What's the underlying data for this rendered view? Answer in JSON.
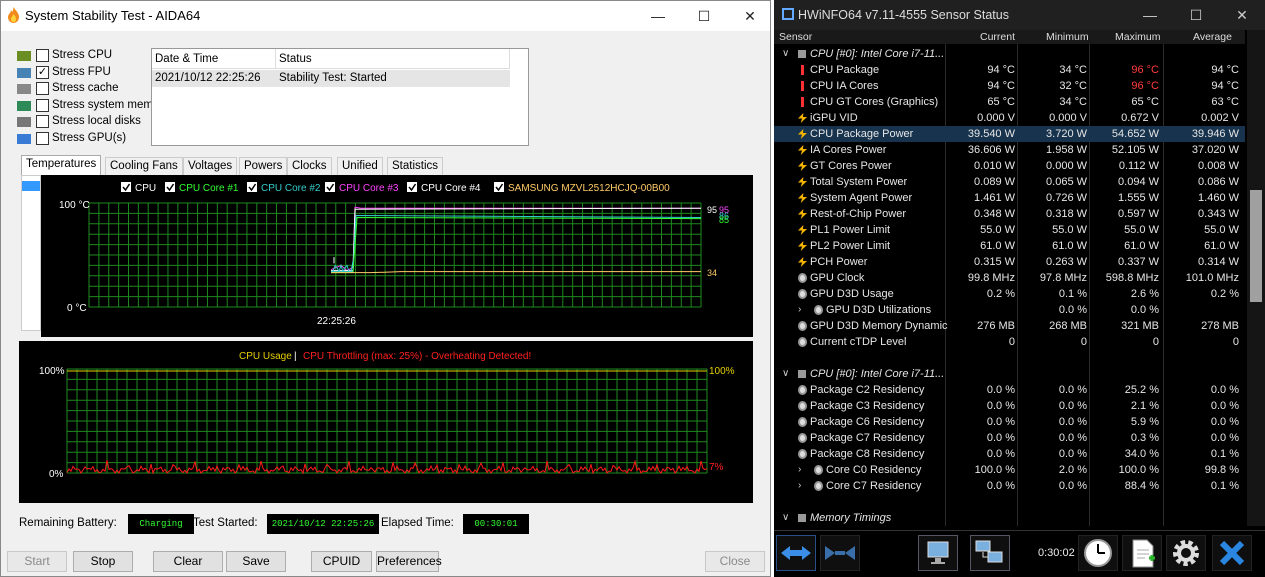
{
  "aida": {
    "title": "System Stability Test - AIDA64",
    "window_controls": {
      "minimize": "—",
      "maximize": "☐",
      "close": "✕"
    },
    "stress": [
      {
        "label": "Stress CPU",
        "checked": false
      },
      {
        "label": "Stress FPU",
        "checked": true
      },
      {
        "label": "Stress cache",
        "checked": false
      },
      {
        "label": "Stress system mem",
        "checked": false
      },
      {
        "label": "Stress local disks",
        "checked": false
      },
      {
        "label": "Stress GPU(s)",
        "checked": false
      }
    ],
    "status_table": {
      "headers": [
        "Date & Time",
        "Status"
      ],
      "rows": [
        [
          "2021/10/12 22:25:26",
          "Stability Test: Started"
        ]
      ]
    },
    "tabs": [
      "Temperatures",
      "Cooling Fans",
      "Voltages",
      "Powers",
      "Clocks",
      "Unified",
      "Statistics"
    ],
    "active_tab": "Temperatures",
    "temp_legend": [
      {
        "label": "CPU",
        "color": "#ffffff"
      },
      {
        "label": "CPU Core #1",
        "color": "#33ff33"
      },
      {
        "label": "CPU Core #2",
        "color": "#33cccc"
      },
      {
        "label": "CPU Core #3",
        "color": "#ff44ff"
      },
      {
        "label": "CPU Core #4",
        "color": "#ffffff"
      },
      {
        "label": "SAMSUNG MZVL2512HCJQ-00B00",
        "color": "#ffcc66"
      }
    ],
    "temp_axis": {
      "top": "100 °C",
      "bottom": "0 °C",
      "time": "22:25:26"
    },
    "temp_readouts": {
      "a": "95",
      "b": "95",
      "c": "86",
      "d": "85",
      "e": "34"
    },
    "usage_title": {
      "a": "CPU Usage",
      "sep": "|",
      "b": "CPU Throttling (max: 25%) - Overheating Detected!"
    },
    "usage_axis": {
      "top_left": "100%",
      "bottom_left": "0%",
      "top_right": "100%",
      "bottom_right": "7%"
    },
    "bottom": {
      "battery_label": "Remaining Battery:",
      "battery_value": "Charging",
      "started_label": "Test Started:",
      "started_value": "2021/10/12 22:25:26",
      "elapsed_label": "Elapsed Time:",
      "elapsed_value": "00:30:01"
    },
    "buttons": {
      "start": "Start",
      "stop": "Stop",
      "clear": "Clear",
      "save": "Save",
      "cpuid": "CPUID",
      "preferences": "Preferences",
      "close": "Close"
    }
  },
  "hwinfo": {
    "title": "HWiNFO64 v7.11-4555 Sensor Status",
    "window_controls": {
      "minimize": "—",
      "maximize": "☐",
      "close": "✕"
    },
    "columns": [
      "Sensor",
      "Current",
      "Minimum",
      "Maximum",
      "Average"
    ],
    "groups": [
      {
        "name": "CPU [#0]: Intel Core i7-11...",
        "rows": [
          {
            "icon": "thermometer-icon",
            "name": "CPU Package",
            "cur": "94 °C",
            "min": "34 °C",
            "max": "96 °C",
            "avg": "94 °C",
            "maxhot": true
          },
          {
            "icon": "thermometer-icon",
            "name": "CPU IA Cores",
            "cur": "94 °C",
            "min": "32 °C",
            "max": "96 °C",
            "avg": "94 °C",
            "maxhot": true
          },
          {
            "icon": "thermometer-icon",
            "name": "CPU GT Cores (Graphics)",
            "cur": "65 °C",
            "min": "34 °C",
            "max": "65 °C",
            "avg": "63 °C"
          },
          {
            "icon": "lightning-icon",
            "name": "iGPU VID",
            "cur": "0.000 V",
            "min": "0.000 V",
            "max": "0.672 V",
            "avg": "0.002 V"
          },
          {
            "icon": "lightning-icon",
            "name": "CPU Package Power",
            "cur": "39.540 W",
            "min": "3.720 W",
            "max": "54.652 W",
            "avg": "39.946 W",
            "selected": true
          },
          {
            "icon": "lightning-icon",
            "name": "IA Cores Power",
            "cur": "36.606 W",
            "min": "1.958 W",
            "max": "52.105 W",
            "avg": "37.020 W"
          },
          {
            "icon": "lightning-icon",
            "name": "GT Cores Power",
            "cur": "0.010 W",
            "min": "0.000 W",
            "max": "0.112 W",
            "avg": "0.008 W"
          },
          {
            "icon": "lightning-icon",
            "name": "Total System Power",
            "cur": "0.089 W",
            "min": "0.065 W",
            "max": "0.094 W",
            "avg": "0.086 W"
          },
          {
            "icon": "lightning-icon",
            "name": "System Agent Power",
            "cur": "1.461 W",
            "min": "0.726 W",
            "max": "1.555 W",
            "avg": "1.460 W"
          },
          {
            "icon": "lightning-icon",
            "name": "Rest-of-Chip Power",
            "cur": "0.348 W",
            "min": "0.318 W",
            "max": "0.597 W",
            "avg": "0.343 W"
          },
          {
            "icon": "lightning-icon",
            "name": "PL1 Power Limit",
            "cur": "55.0 W",
            "min": "55.0 W",
            "max": "55.0 W",
            "avg": "55.0 W"
          },
          {
            "icon": "lightning-icon",
            "name": "PL2 Power Limit",
            "cur": "61.0 W",
            "min": "61.0 W",
            "max": "61.0 W",
            "avg": "61.0 W"
          },
          {
            "icon": "lightning-icon",
            "name": "PCH Power",
            "cur": "0.315 W",
            "min": "0.263 W",
            "max": "0.337 W",
            "avg": "0.314 W"
          },
          {
            "icon": "gauge-icon",
            "name": "GPU Clock",
            "cur": "99.8 MHz",
            "min": "97.8 MHz",
            "max": "598.8 MHz",
            "avg": "101.0 MHz"
          },
          {
            "icon": "gauge-icon",
            "name": "GPU D3D Usage",
            "cur": "0.2 %",
            "min": "0.1 %",
            "max": "2.6 %",
            "avg": "0.2 %"
          },
          {
            "icon": "gauge-icon",
            "name": "GPU D3D Utilizations",
            "cur": "",
            "min": "0.0 %",
            "max": "0.0 %",
            "avg": "",
            "sub": true
          },
          {
            "icon": "gauge-icon",
            "name": "GPU D3D Memory Dynamic",
            "cur": "276 MB",
            "min": "268 MB",
            "max": "321 MB",
            "avg": "278 MB"
          },
          {
            "icon": "gauge-icon",
            "name": "Current cTDP Level",
            "cur": "0",
            "min": "0",
            "max": "0",
            "avg": "0"
          }
        ]
      },
      {
        "name": "CPU [#0]: Intel Core i7-11...",
        "rows": [
          {
            "icon": "gauge-icon",
            "name": "Package C2 Residency",
            "cur": "0.0 %",
            "min": "0.0 %",
            "max": "25.2 %",
            "avg": "0.0 %"
          },
          {
            "icon": "gauge-icon",
            "name": "Package C3 Residency",
            "cur": "0.0 %",
            "min": "0.0 %",
            "max": "2.1 %",
            "avg": "0.0 %"
          },
          {
            "icon": "gauge-icon",
            "name": "Package C6 Residency",
            "cur": "0.0 %",
            "min": "0.0 %",
            "max": "5.9 %",
            "avg": "0.0 %"
          },
          {
            "icon": "gauge-icon",
            "name": "Package C7 Residency",
            "cur": "0.0 %",
            "min": "0.0 %",
            "max": "0.3 %",
            "avg": "0.0 %"
          },
          {
            "icon": "gauge-icon",
            "name": "Package C8 Residency",
            "cur": "0.0 %",
            "min": "0.0 %",
            "max": "34.0 %",
            "avg": "0.1 %"
          },
          {
            "icon": "gauge-icon",
            "name": "Core C0 Residency",
            "cur": "100.0 %",
            "min": "2.0 %",
            "max": "100.0 %",
            "avg": "99.8 %",
            "sub": true
          },
          {
            "icon": "gauge-icon",
            "name": "Core C7 Residency",
            "cur": "0.0 %",
            "min": "0.0 %",
            "max": "88.4 %",
            "avg": "0.1 %",
            "sub": true
          }
        ]
      },
      {
        "name": "Memory Timings",
        "rows": []
      }
    ],
    "elapsed": "0:30:02"
  }
}
